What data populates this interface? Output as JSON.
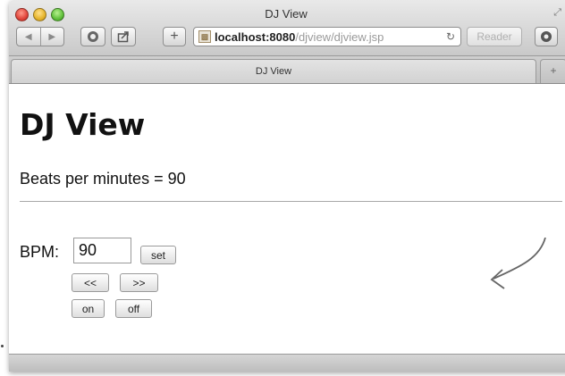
{
  "window": {
    "title": "DJ View"
  },
  "toolbar": {
    "back_icon": "back-arrow-icon",
    "forward_icon": "forward-arrow-icon",
    "address_host": "localhost:8080",
    "address_path": "/djview/djview.jsp",
    "reader_label": "Reader"
  },
  "tab": {
    "label": "DJ View"
  },
  "page": {
    "heading": "DJ View",
    "bpm_status": "Beats per minutes = 90",
    "bpm_label": "BPM:",
    "bpm_value": "90",
    "set_label": "set",
    "decrease_label": "<<",
    "increase_label": ">>",
    "on_label": "on",
    "off_label": "off"
  }
}
